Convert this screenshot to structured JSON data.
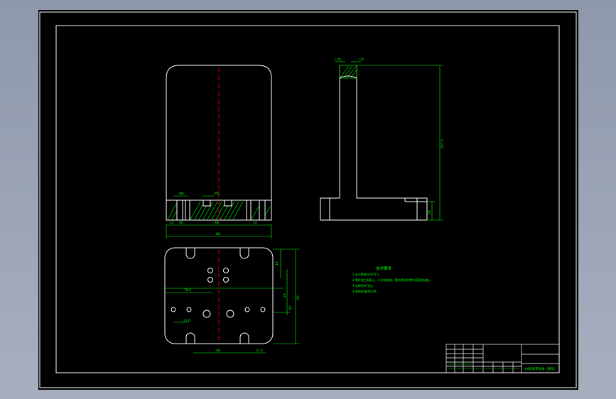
{
  "colors": {
    "background": "#000000",
    "frame": "#ffffff",
    "dimension": "#00ff00",
    "centerline": "#ff0000",
    "hatch": "#00ff00",
    "chrome": "#9aa3b5"
  },
  "front_view": {
    "callouts": [
      "M6",
      "M5"
    ],
    "dims": [
      "12",
      "20",
      "48",
      "14",
      "68"
    ]
  },
  "plan_view": {
    "dims_bottom": [
      "21.6",
      "48",
      "21.6"
    ],
    "dims_left": [
      "78.5"
    ],
    "dims_right": [
      "14",
      "23",
      "60",
      "80"
    ]
  },
  "side_view": {
    "dims_top": [
      "1.20",
      "R2"
    ],
    "dims_right": [
      "187.3",
      "28"
    ]
  },
  "tech_notes": {
    "title": "技术要求",
    "lines": [
      "1.未注倒角均为C0.5。",
      "2.零件加工表面上，不应有划痕、擦伤等损伤零件表面的缺陷。",
      "3.去除毛刺飞边。",
      "4.调质处理HB200。"
    ]
  },
  "title_block": {
    "drawing_name": "XX机床夹具体（图号）"
  }
}
